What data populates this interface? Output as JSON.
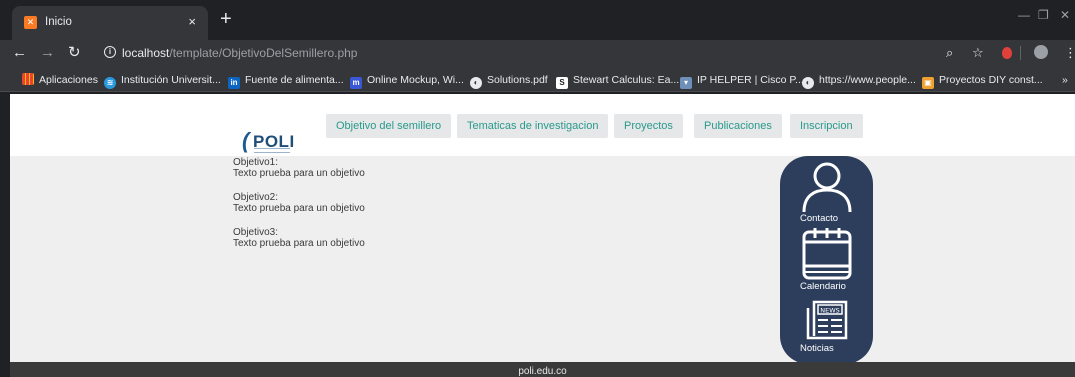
{
  "browser": {
    "tab_title": "Inicio",
    "tab_close": "×",
    "new_tab": "+",
    "url_host": "localhost",
    "url_path": "/template/ObjetivoDelSemillero.php",
    "bookmarks": [
      {
        "label": "Aplicaciones",
        "icon": "apps-grid-icon",
        "color": "#e8eaed"
      },
      {
        "label": "Institución Universit...",
        "icon": "university-icon",
        "color": "#2a9adf"
      },
      {
        "label": "Fuente de alimenta...",
        "icon": "linkedin-icon",
        "color": "#0a66c2"
      },
      {
        "label": "Online Mockup, Wi...",
        "icon": "mockup-icon",
        "color": "#3a57d6"
      },
      {
        "label": "Solutions.pdf",
        "icon": "globe-icon",
        "color": "#e8eaed"
      },
      {
        "label": "Stewart Calculus: Ea...",
        "icon": "scribd-icon",
        "color": "#1e1e1e"
      },
      {
        "label": "IP HELPER | Cisco P...",
        "icon": "iphelper-icon",
        "color": "#6e8fb7"
      },
      {
        "label": "https://www.people...",
        "icon": "globe-icon",
        "color": "#e8eaed"
      },
      {
        "label": "Proyectos DIY const...",
        "icon": "diy-icon",
        "color": "#f0a030"
      }
    ],
    "bookmarks_more": "»"
  },
  "site": {
    "nav": [
      {
        "label": "Objetivo del semillero"
      },
      {
        "label": "Tematicas de investigacion"
      },
      {
        "label": "Proyectos"
      },
      {
        "label": "Publicaciones"
      },
      {
        "label": "Inscripcion"
      }
    ],
    "logo_text": "POLI",
    "objectives": [
      {
        "title": "Objetivo1:",
        "text": "Texto prueba para un objetivo"
      },
      {
        "title": "Objetivo2:",
        "text": "Texto prueba para un objetivo"
      },
      {
        "title": "Objetivo3:",
        "text": "Texto prueba para un objetivo"
      }
    ],
    "side": {
      "contacto": "Contacto",
      "calendario": "Calendario",
      "noticias": "Noticias",
      "news_badge": "NEWS"
    },
    "footer": "poli.edu.co"
  },
  "colors": {
    "accent_nav_text": "#2a9a8a",
    "side_panel": "#2c3e5c",
    "page_bg": "#efefef"
  }
}
